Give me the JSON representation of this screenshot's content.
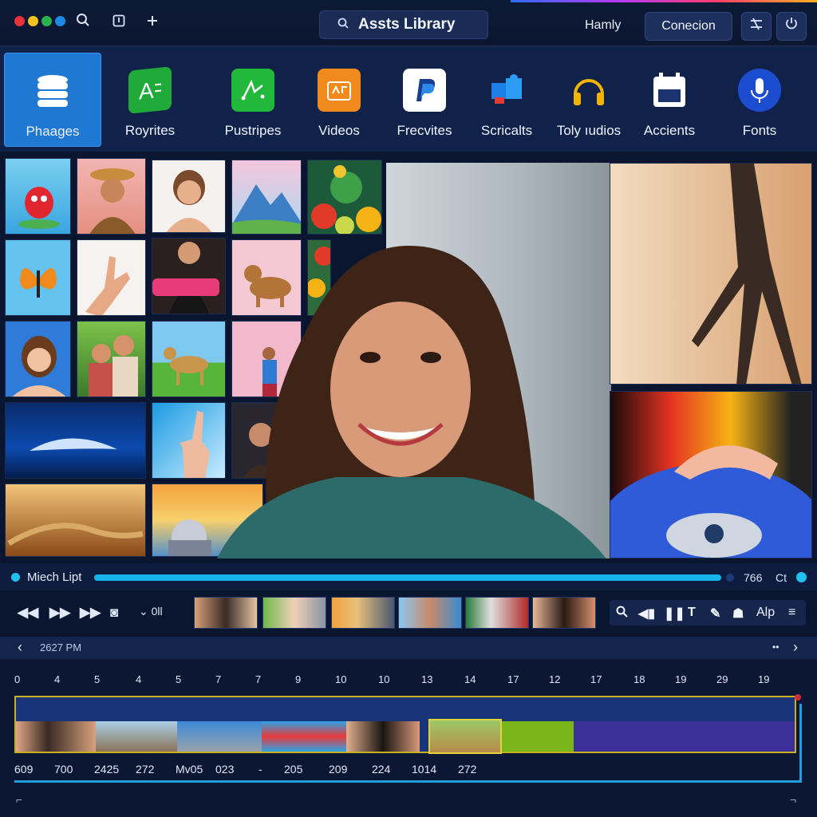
{
  "topbar": {
    "window_dots": [
      "#e8323c",
      "#f4c21c",
      "#2bb24c",
      "#1e88e5"
    ],
    "title": "Assts Library",
    "link": "Hamly",
    "connect_label": "Conecion"
  },
  "categories": [
    {
      "label": "Phaages",
      "icon": "database-icon",
      "active": true
    },
    {
      "label": "Royrites",
      "icon": "text-tag-icon",
      "active": false
    },
    {
      "label": "Pustripes",
      "icon": "draw-icon",
      "active": false
    },
    {
      "label": "Videos",
      "icon": "video-icon",
      "active": false
    },
    {
      "label": "Frecvites",
      "icon": "p-logo-icon",
      "active": false
    },
    {
      "label": "Scricalts",
      "icon": "puzzle-icon",
      "active": false
    },
    {
      "label": "Toly ıudios",
      "icon": "headphones-icon",
      "active": false
    },
    {
      "label": "Accients",
      "icon": "calendar-icon",
      "active": false
    },
    {
      "label": "Fonts",
      "icon": "microphone-icon",
      "active": false
    }
  ],
  "media_strip": {
    "label": "Miech Lipt",
    "progress": 0.995,
    "right_values": [
      "766",
      "Ct"
    ]
  },
  "transport": {
    "mode_label": "⌄ 0ll",
    "tool_label": "Alp"
  },
  "nav": {
    "time": "2627 PM",
    "more": "••"
  },
  "timeline": {
    "ruler": [
      "0",
      "4",
      "5",
      "4",
      "5",
      "7",
      "7",
      "9",
      "10",
      "10",
      "13",
      "14",
      "17",
      "12",
      "17",
      "18",
      "19",
      "29",
      "19"
    ],
    "values": [
      "609",
      "700",
      "2425",
      "272",
      "Mv05",
      "023",
      "-",
      "205",
      "209",
      "224",
      "1014",
      "272"
    ]
  },
  "colors": {
    "accent": "#1f78d1",
    "progress": "#17b4ea",
    "selection": "#e2d23c",
    "background": "#0a1630"
  }
}
